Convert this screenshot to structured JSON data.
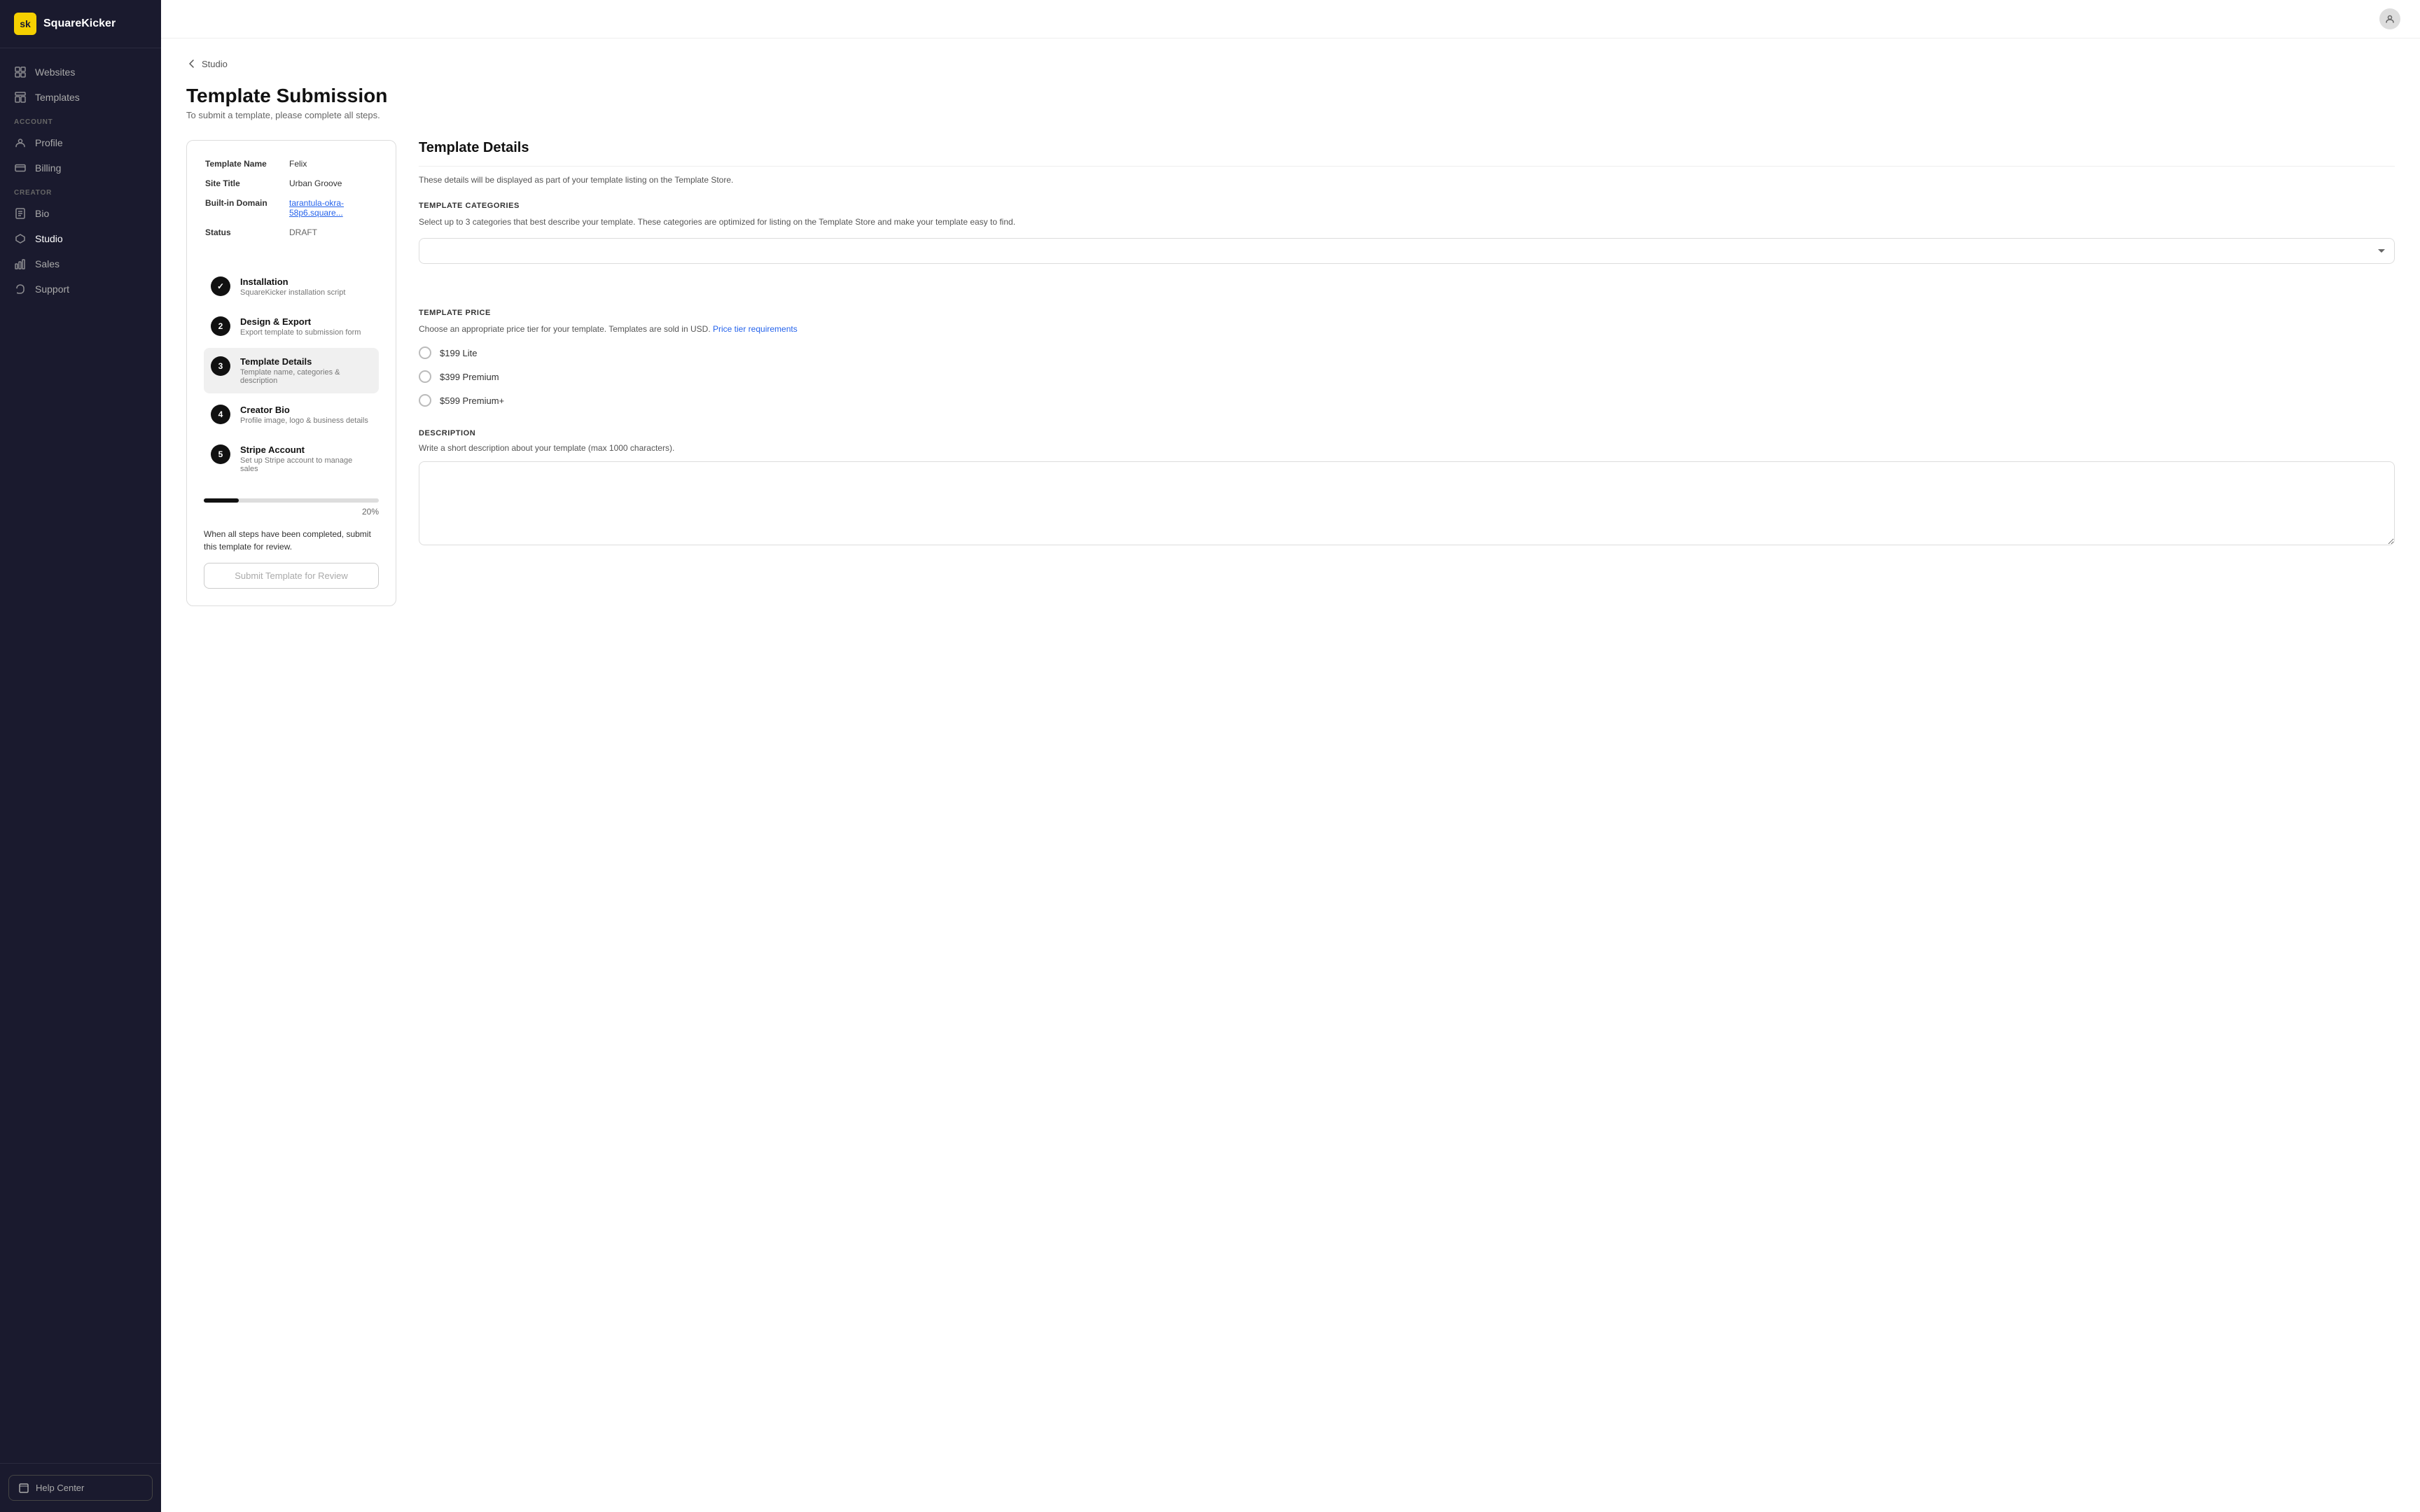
{
  "app": {
    "logo_text": "sk",
    "brand_name": "SquareKicker"
  },
  "sidebar": {
    "nav_items": [
      {
        "id": "websites",
        "label": "Websites",
        "icon": "⬜"
      },
      {
        "id": "templates",
        "label": "Templates",
        "icon": "⊞"
      }
    ],
    "account_label": "ACCOUNT",
    "account_items": [
      {
        "id": "profile",
        "label": "Profile",
        "icon": "👤"
      },
      {
        "id": "billing",
        "label": "Billing",
        "icon": "💳"
      }
    ],
    "creator_label": "CREATOR",
    "creator_items": [
      {
        "id": "bio",
        "label": "Bio",
        "icon": "🪪"
      },
      {
        "id": "studio",
        "label": "Studio",
        "icon": "⬡"
      },
      {
        "id": "sales",
        "label": "Sales",
        "icon": "📊"
      },
      {
        "id": "support",
        "label": "Support",
        "icon": "💬"
      }
    ],
    "help_label": "Help Center"
  },
  "back": {
    "label": "Studio"
  },
  "page": {
    "title": "Template Submission",
    "subtitle": "To submit a template, please complete all steps."
  },
  "template_info": {
    "name_label": "Template Name",
    "name_value": "Felix",
    "site_title_label": "Site Title",
    "site_title_value": "Urban Groove",
    "domain_label": "Built-in Domain",
    "domain_value": "tarantula-okra-58p6.square...",
    "status_label": "Status",
    "status_value": "DRAFT"
  },
  "steps": [
    {
      "number": "✓",
      "title": "Installation",
      "desc": "SquareKicker installation script",
      "state": "complete"
    },
    {
      "number": "2",
      "title": "Design & Export",
      "desc": "Export template to submission form",
      "state": "pending"
    },
    {
      "number": "3",
      "title": "Template Details",
      "desc": "Template name, categories & description",
      "state": "active"
    },
    {
      "number": "4",
      "title": "Creator Bio",
      "desc": "Profile image, logo & business details",
      "state": "pending"
    },
    {
      "number": "5",
      "title": "Stripe Account",
      "desc": "Set up Stripe account to manage sales",
      "state": "pending"
    }
  ],
  "progress": {
    "percentage": 20,
    "label": "20%"
  },
  "completion_note": "When all steps have been completed, submit this template for review.",
  "submit_btn": "Submit Template for Review",
  "right_panel": {
    "title": "Template Details",
    "desc": "These details will be displayed as part of your template listing on the Template Store.",
    "categories": {
      "label": "TEMPLATE CATEGORIES",
      "help": "Select up to 3 categories that best describe your template. These categories are optimized for listing on the Template Store and make your template easy to find.",
      "placeholder": ""
    },
    "price": {
      "label": "TEMPLATE PRICE",
      "help": "Choose an appropriate price tier for your template. Templates are sold in USD.",
      "link_text": "Price tier requirements",
      "options": [
        {
          "id": "lite",
          "label": "$199 Lite"
        },
        {
          "id": "premium",
          "label": "$399 Premium"
        },
        {
          "id": "premium_plus",
          "label": "$599 Premium+"
        }
      ]
    },
    "description": {
      "label": "DESCRIPTION",
      "help": "Write a short description about your template (max 1000 characters).",
      "placeholder": ""
    }
  }
}
